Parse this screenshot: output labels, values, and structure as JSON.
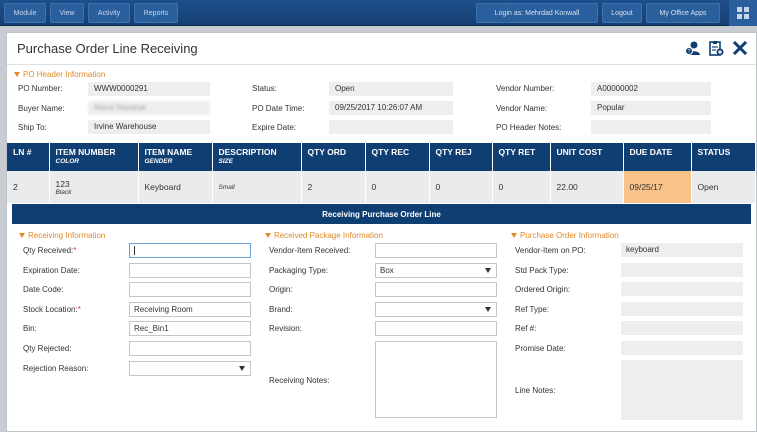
{
  "topbar": {
    "menus": [
      "Module",
      "View",
      "Activity",
      "Reports"
    ],
    "login": "Login as: Mehrdad Konwall",
    "logout": "Logout",
    "office": "My Office Apps"
  },
  "title": "Purchase Order Line Receiving",
  "header": {
    "section_title": "PO Header Information",
    "po_number_label": "PO Number:",
    "po_number": "WWW0000291",
    "buyer_name_label": "Buyer Name:",
    "buyer_name": "Maria Nazahat",
    "ship_to_label": "Ship To:",
    "ship_to": "Irvine Warehouse",
    "status_label": "Status:",
    "status": "Open",
    "po_date_label": "PO Date Time:",
    "po_date": "09/25/2017 10:26:07 AM",
    "expire_label": "Expire Date:",
    "expire": "",
    "vendor_number_label": "Vendor Number:",
    "vendor_number": "A00000002",
    "vendor_name_label": "Vendor Name:",
    "vendor_name": "Popular",
    "notes_label": "PO Header Notes:",
    "notes": ""
  },
  "lines": {
    "columns": [
      {
        "label": "LN #",
        "sub": ""
      },
      {
        "label": "ITEM NUMBER",
        "sub": "COLOR"
      },
      {
        "label": "ITEM NAME",
        "sub": "GENDER"
      },
      {
        "label": "DESCRIPTION",
        "sub": "SIZE"
      },
      {
        "label": "QTY ORD",
        "sub": ""
      },
      {
        "label": "QTY REC",
        "sub": ""
      },
      {
        "label": "QTY REJ",
        "sub": ""
      },
      {
        "label": "QTY RET",
        "sub": ""
      },
      {
        "label": "UNIT COST",
        "sub": ""
      },
      {
        "label": "DUE DATE",
        "sub": ""
      },
      {
        "label": "STATUS",
        "sub": ""
      }
    ],
    "row": {
      "ln": "2",
      "item_number": "123",
      "color": "Black",
      "item_name": "Keyboard",
      "description": "",
      "size": "Small",
      "qty_ord": "2",
      "qty_rec": "0",
      "qty_rej": "0",
      "qty_ret": "0",
      "unit_cost": "22.00",
      "due_date": "09/25/17",
      "status": "Open"
    }
  },
  "receiving_bar": "Receiving Purchase Order Line",
  "receiving": {
    "section_title": "Receiving Information",
    "qty_received_label": "Qty Received:",
    "expiration_label": "Expiration Date:",
    "date_code_label": "Date Code:",
    "stock_location_label": "Stock Location:",
    "stock_location": "Receiving Room",
    "bin_label": "Bin:",
    "bin": "Rec_Bin1",
    "qty_rejected_label": "Qty Rejected:",
    "rejection_reason_label": "Rejection Reason:"
  },
  "package": {
    "section_title": "Received Package Information",
    "vendor_item_label": "Vendor-Item Received:",
    "packaging_label": "Packaging Type:",
    "packaging": "Box",
    "origin_label": "Origin:",
    "brand_label": "Brand:",
    "revision_label": "Revision:",
    "notes_label": "Receiving Notes:"
  },
  "po_info": {
    "section_title": "Purchase Order Information",
    "vendor_item_label": "Vendor-Item on PO:",
    "vendor_item": "keyboard",
    "std_pack_label": "Std Pack Type:",
    "ordered_origin_label": "Ordered Origin:",
    "ref_type_label": "Ref Type:",
    "ref_no_label": "Ref #:",
    "promise_label": "Promise Date:",
    "line_notes_label": "Line Notes:"
  },
  "colors": {
    "navy": "#0f3e73",
    "accent": "#e08a2a",
    "due_highlight": "#f9c289"
  }
}
